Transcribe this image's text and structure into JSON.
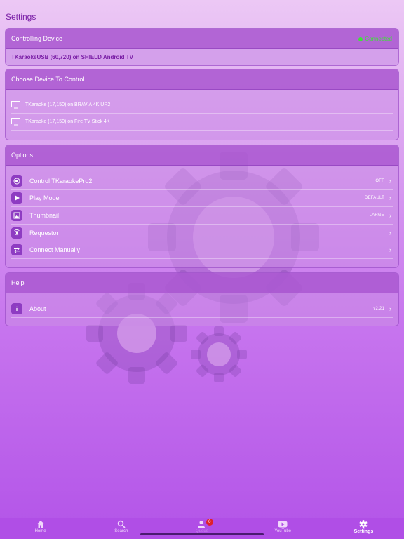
{
  "page_title": "Settings",
  "controlling": {
    "header": "Controlling Device",
    "status": "Connected",
    "device": "TKaraokeUSB (60,720) on SHIELD Android TV"
  },
  "choose": {
    "header": "Choose Device To Control",
    "devices": [
      {
        "label": "TKaraoke (17,150) on BRAVIA 4K UR2",
        "icon": "tv-icon"
      },
      {
        "label": "TKaraoke (17,150) on Fire TV Stick 4K",
        "icon": "tv-icon"
      }
    ]
  },
  "options": {
    "header": "Options",
    "items": [
      {
        "label": "Control TKaraokePro2",
        "value": "OFF",
        "icon": "target-icon"
      },
      {
        "label": "Play Mode",
        "value": "DEFAULT",
        "icon": "play-icon"
      },
      {
        "label": "Thumbnail",
        "value": "LARGE",
        "icon": "image-icon"
      },
      {
        "label": "Requestor",
        "value": "",
        "icon": "broadcast-icon"
      },
      {
        "label": "Connect Manually",
        "value": "",
        "icon": "swap-icon"
      }
    ]
  },
  "help": {
    "header": "Help",
    "items": [
      {
        "label": "About",
        "value": "v2.21",
        "icon": "info-icon"
      }
    ]
  },
  "tabbar": {
    "tabs": [
      {
        "label": "Home",
        "icon": "home-icon"
      },
      {
        "label": "Search",
        "icon": "search-icon"
      },
      {
        "label": "Queue",
        "icon": "queue-icon",
        "badge": "0"
      },
      {
        "label": "YouTube",
        "icon": "youtube-icon"
      },
      {
        "label": "Settings",
        "icon": "gear-icon"
      }
    ],
    "active": "Settings"
  },
  "colors": {
    "accent": "#7a1ea6",
    "connected": "#3fe03a",
    "tabbar": "#b04ee6",
    "badge": "#e0202a"
  }
}
